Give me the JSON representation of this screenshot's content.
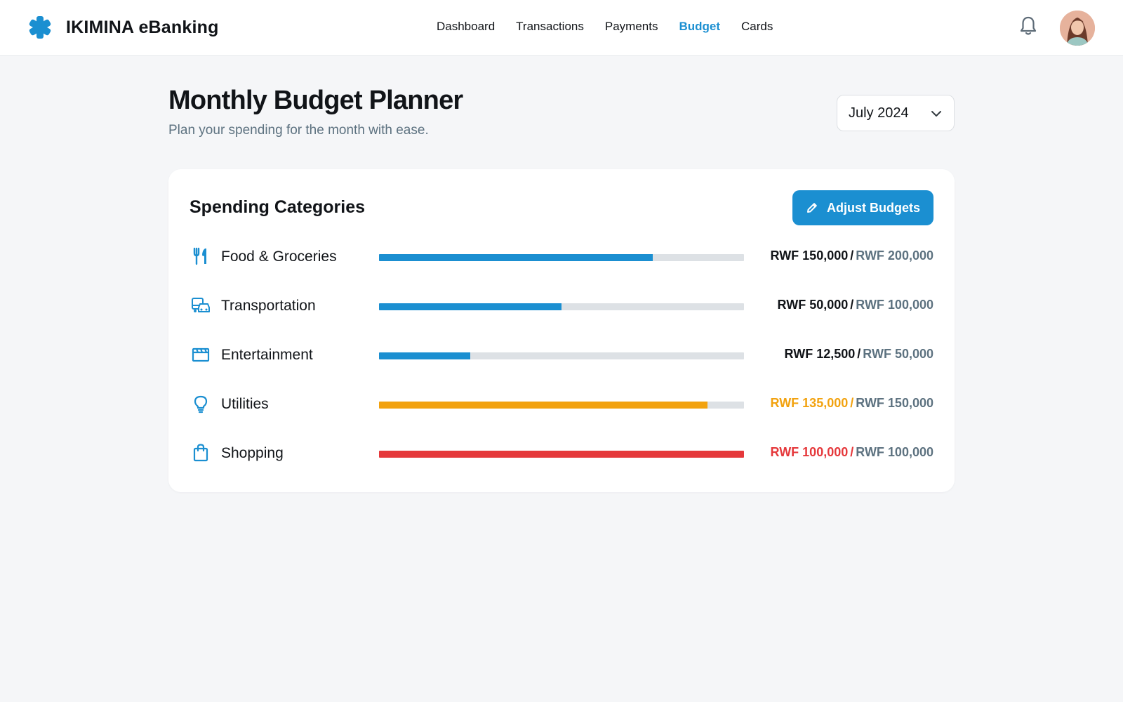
{
  "app": {
    "brand_name": "IKIMINA eBanking",
    "brand_color": "#1b8fd1"
  },
  "nav": {
    "items": [
      {
        "label": "Dashboard",
        "active": false
      },
      {
        "label": "Transactions",
        "active": false
      },
      {
        "label": "Payments",
        "active": false
      },
      {
        "label": "Budget",
        "active": true
      },
      {
        "label": "Cards",
        "active": false
      }
    ]
  },
  "header": {
    "title": "Monthly Budget Planner",
    "subtitle": "Plan your spending for the month with ease.",
    "month_select": {
      "value": "July 2024"
    }
  },
  "categories_card": {
    "title": "Spending Categories",
    "adjust_button_label": "Adjust Budgets",
    "separator": "/",
    "items": [
      {
        "label": "Food & Groceries",
        "icon": "utensils-icon",
        "spent": "RWF 150,000",
        "budget": "RWF 200,000",
        "progress": 0.75,
        "status_color": "#1b8fd1",
        "amount_color": "#111418"
      },
      {
        "label": "Transportation",
        "icon": "vehicle-icon",
        "spent": "RWF 50,000",
        "budget": "RWF 100,000",
        "progress": 0.5,
        "status_color": "#1b8fd1",
        "amount_color": "#111418"
      },
      {
        "label": "Entertainment",
        "icon": "clapperboard-icon",
        "spent": "RWF 12,500",
        "budget": "RWF 50,000",
        "progress": 0.25,
        "status_color": "#1b8fd1",
        "amount_color": "#111418"
      },
      {
        "label": "Utilities",
        "icon": "lightbulb-icon",
        "spent": "RWF 135,000",
        "budget": "RWF 150,000",
        "progress": 0.9,
        "status_color": "#f2a20f",
        "amount_color": "#f2a20f"
      },
      {
        "label": "Shopping",
        "icon": "shopping-bag-icon",
        "spent": "RWF 100,000",
        "budget": "RWF 100,000",
        "progress": 1.0,
        "status_color": "#e5383b",
        "amount_color": "#e5383b"
      }
    ]
  },
  "colors": {
    "accent": "#1b8fd1",
    "warning": "#f2a20f",
    "danger": "#e5383b",
    "track": "#dde1e5",
    "muted_text": "#5d7280"
  }
}
